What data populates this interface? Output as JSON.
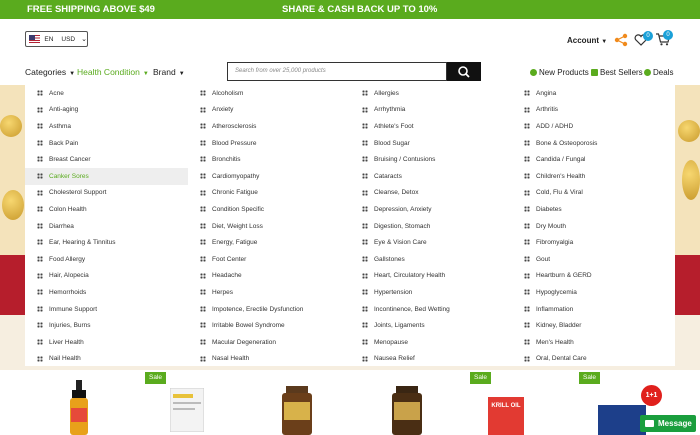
{
  "topbar": {
    "free_shipping": "FREE SHIPPING ABOVE $49",
    "cashback": "SHARE & CASH BACK UP TO 10%",
    "background": "#5aab1e"
  },
  "currency": {
    "language": "EN",
    "currency": "USD"
  },
  "header": {
    "account_label": "Account",
    "wishlist_count": "0",
    "cart_count": "0"
  },
  "nav": {
    "categories": "Categories",
    "health_condition": "Health Condition",
    "brand": "Brand",
    "accent": "#5aab1e"
  },
  "search": {
    "placeholder": "Search from over 25,000 products"
  },
  "quick_links": {
    "new_products": "New Products",
    "best_sellers": "Best Sellers",
    "deals": "Deals"
  },
  "menu": {
    "columns": [
      [
        "Acne",
        "Anti-aging",
        "Asthma",
        "Back Pain",
        "Breast Cancer",
        "Canker Sores",
        "Cholesterol Support",
        "Colon Health",
        "Diarrhea",
        "Ear, Hearing & Tinnitus",
        "Food Allergy",
        "Hair, Alopecia",
        "Hemorrhoids",
        "Immune Support",
        "Injuries, Burns",
        "Liver Health",
        "Nail Health"
      ],
      [
        "Alcoholism",
        "Anxiety",
        "Atherosclerosis",
        "Blood Pressure",
        "Bronchitis",
        "Cardiomyopathy",
        "Chronic Fatigue",
        "Condition Specific",
        "Diet, Weight Loss",
        "Energy, Fatigue",
        "Foot Center",
        "Headache",
        "Herpes",
        "Impotence, Erectile Dysfunction",
        "Irritable Bowel Syndrome",
        "Macular Degeneration",
        "Nasal Health"
      ],
      [
        "Allergies",
        "Arrhythmia",
        "Athlete's Foot",
        "Blood Sugar",
        "Bruising / Contusions",
        "Cataracts",
        "Cleanse, Detox",
        "Depression, Anxiety",
        "Digestion, Stomach",
        "Eye & Vision Care",
        "Gallstones",
        "Heart, Circulatory Health",
        "Hypertension",
        "Incontinence, Bed Wetting",
        "Joints, Ligaments",
        "Menopause",
        "Nausea Relief"
      ],
      [
        "Angina",
        "Arthritis",
        "ADD / ADHD",
        "Bone & Osteoporosis",
        "Candida / Fungal",
        "Children's Health",
        "Cold, Flu & Viral",
        "Diabetes",
        "Dry Mouth",
        "Fibromyalgia",
        "Gout",
        "Heartburn & GERD",
        "Hypoglycemia",
        "Inflammation",
        "Kidney, Bladder",
        "Men's Health",
        "Oral, Dental Care"
      ]
    ],
    "active_item": "Canker Sores"
  },
  "products": {
    "sale_label": "Sale",
    "krill_label": "KRILL OIL"
  },
  "chat": {
    "promo_badge": "1+1",
    "message_label": "Message"
  }
}
